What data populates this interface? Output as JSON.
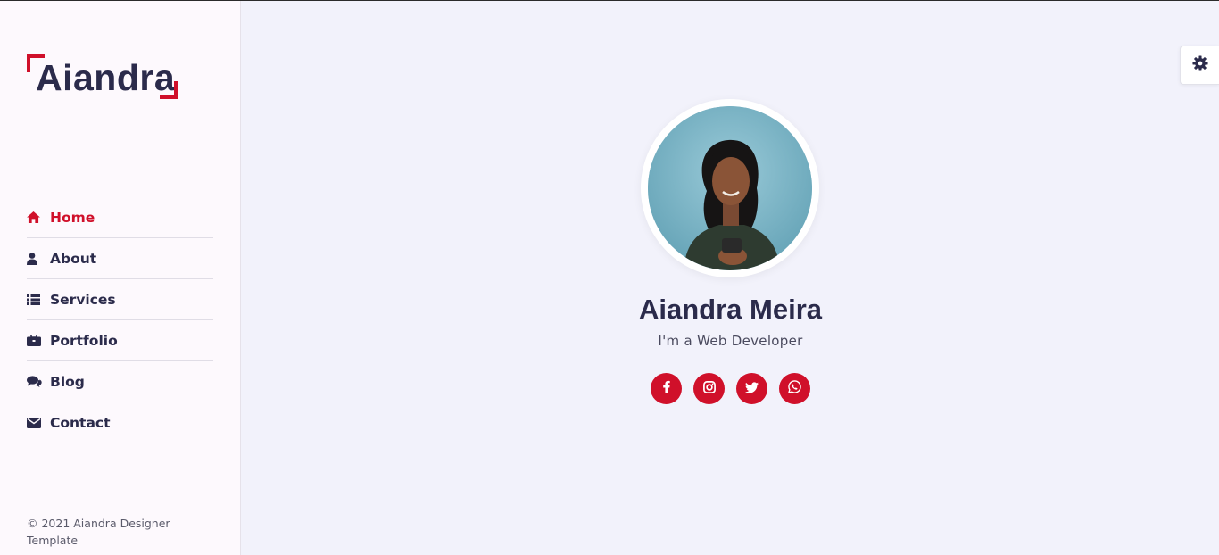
{
  "brand": {
    "logo_text": "Aiandra",
    "accent_color": "#d0102a",
    "text_color": "#2b2b4b"
  },
  "nav": {
    "items": [
      {
        "label": "Home",
        "icon": "home-icon",
        "active": true
      },
      {
        "label": "About",
        "icon": "user-icon",
        "active": false
      },
      {
        "label": "Services",
        "icon": "list-icon",
        "active": false
      },
      {
        "label": "Portfolio",
        "icon": "briefcase-icon",
        "active": false
      },
      {
        "label": "Blog",
        "icon": "comments-icon",
        "active": false
      },
      {
        "label": "Contact",
        "icon": "envelope-icon",
        "active": false
      }
    ]
  },
  "footer": {
    "copyright": "© 2021 Aiandra Designer Template"
  },
  "hero": {
    "name": "Aiandra Meira",
    "role": "I'm a Web Developer",
    "socials": [
      "facebook-icon",
      "instagram-icon",
      "twitter-icon",
      "whatsapp-icon"
    ]
  },
  "settings": {
    "icon": "gear-icon"
  }
}
